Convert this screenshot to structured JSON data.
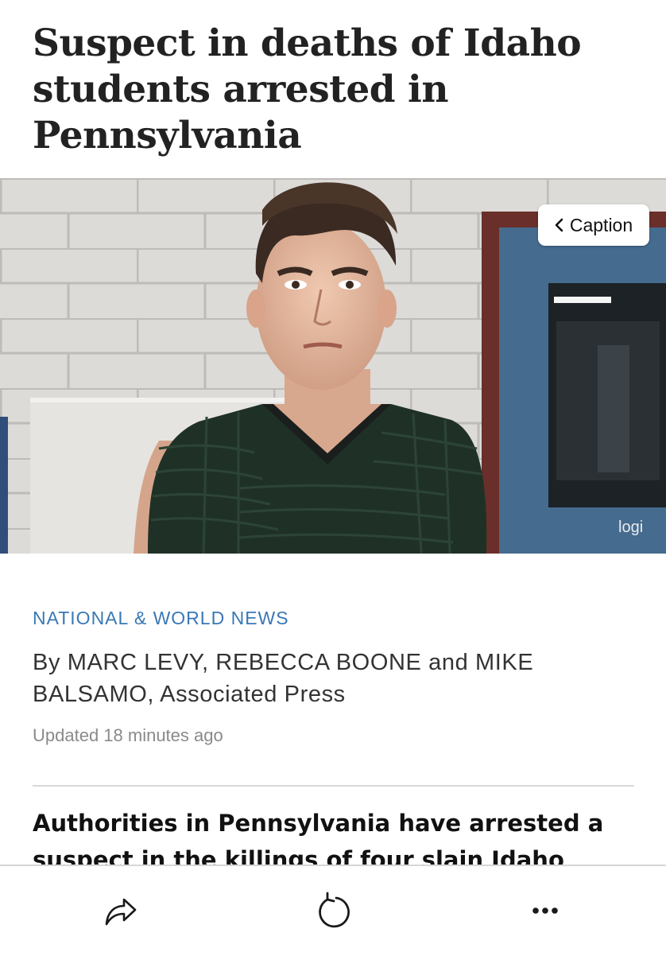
{
  "article": {
    "headline": "Suspect in deaths of Idaho students arrested in Pennsylvania",
    "section": "NATIONAL & WORLD NEWS",
    "byline": "By MARC LEVY, REBECCA BOONE and MIKE BALSAMO, Associated Press",
    "updated": "Updated 18 minutes ago",
    "lede": "Authorities in Pennsylvania have arrested a suspect in the killings of four slain Idaho"
  },
  "photo": {
    "caption_label": "Caption",
    "caption_icon": "chevron-left-icon",
    "watermark": "logi"
  },
  "toolbar": {
    "share_icon": "share-icon",
    "refresh_icon": "refresh-icon",
    "more_icon": "more-icon"
  },
  "colors": {
    "section_link": "#3a78b5",
    "door_frame": "#6a2f2a",
    "door": "#456b8e"
  }
}
